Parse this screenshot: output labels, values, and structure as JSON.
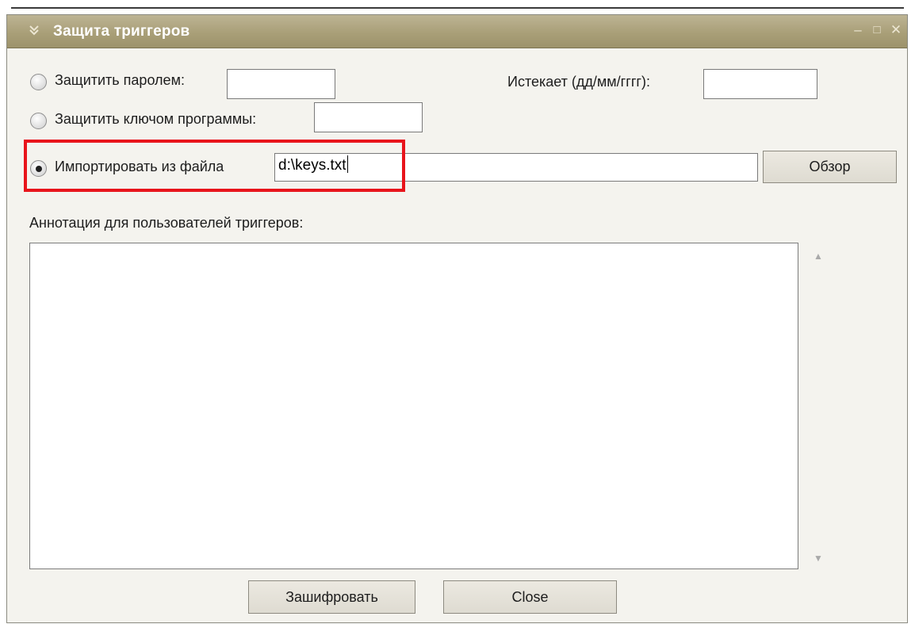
{
  "window": {
    "title": "Защита триггеров"
  },
  "protect_password": {
    "label": "Защитить паролем:",
    "value": ""
  },
  "expires": {
    "label": "Истекает (дд/мм/гггг):",
    "value": ""
  },
  "protect_program_key": {
    "label": "Защитить ключом программы:",
    "value": ""
  },
  "import_file": {
    "label": "Импортировать из файла",
    "value": "d:\\keys.txt",
    "selected": true
  },
  "browse_label": "Обзор",
  "annotation": {
    "label": "Аннотация для пользователей триггеров:",
    "value": ""
  },
  "buttons": {
    "encrypt_label": "Зашифровать",
    "close_label": "Close"
  },
  "colors": {
    "titlebar": "#a99f78",
    "highlight": "#e8141b",
    "window_bg": "#f4f3ee"
  }
}
